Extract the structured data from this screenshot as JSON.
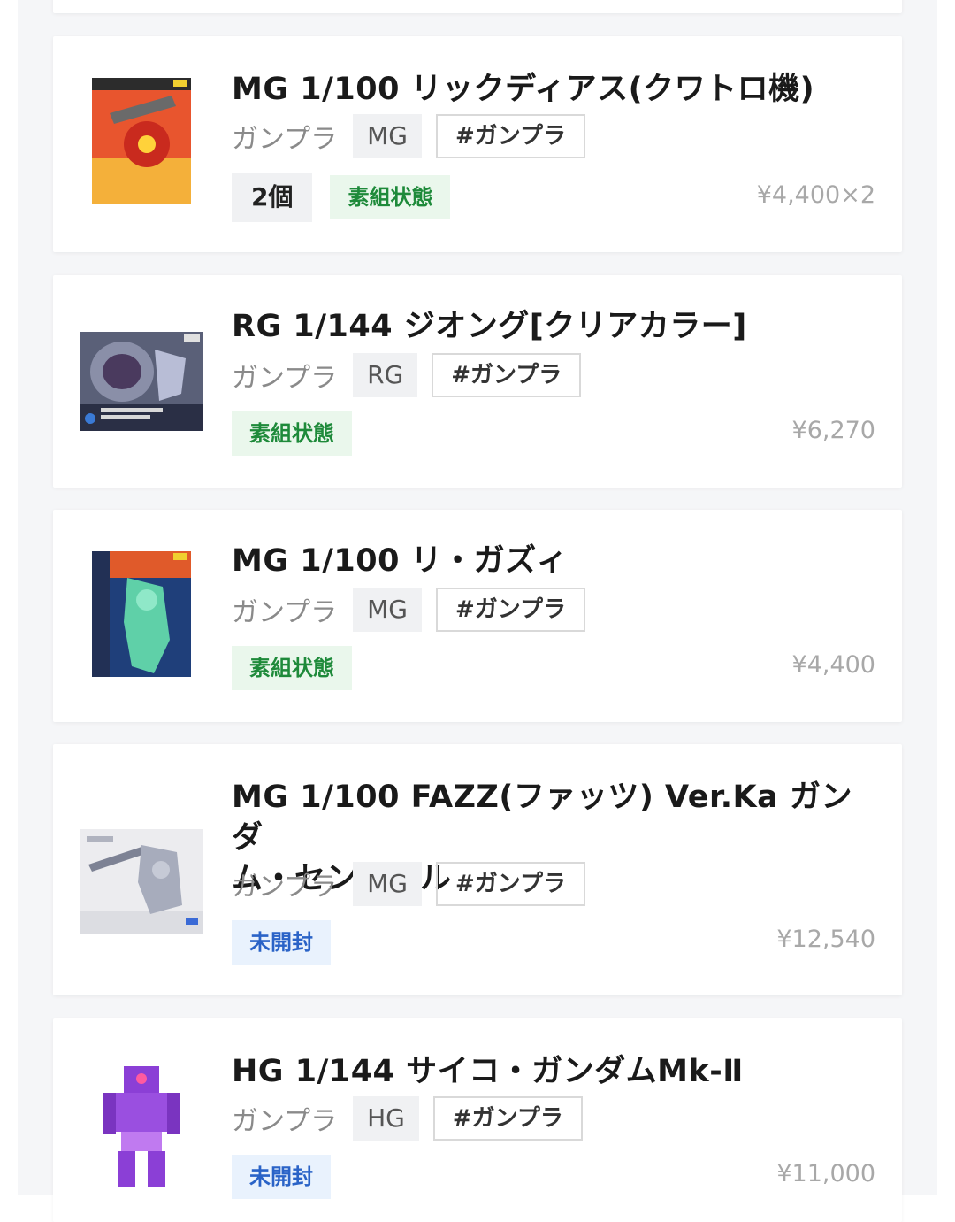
{
  "items": [
    {
      "title": "MG 1/100 リックディアス(クワトロ機)",
      "category": "ガンプラ",
      "series": "MG",
      "hashtag": "#ガンプラ",
      "quantity": "2個",
      "condition": "素組状態",
      "condition_color": "#1e8a3a",
      "price": "¥4,400×2",
      "thumb_colors": [
        "#d3402a",
        "#f0a020"
      ]
    },
    {
      "title": "RG 1/144 ジオング[クリアカラー]",
      "category": "ガンプラ",
      "series": "RG",
      "hashtag": "#ガンプラ",
      "condition": "素組状態",
      "condition_color": "#1e8a3a",
      "price": "¥6,270",
      "thumb_colors": [
        "#4a4f66",
        "#9aa0b8"
      ]
    },
    {
      "title": "MG 1/100 リ・ガズィ",
      "category": "ガンプラ",
      "series": "MG",
      "hashtag": "#ガンプラ",
      "condition": "素組状態",
      "condition_color": "#1e8a3a",
      "price": "¥4,400",
      "thumb_colors": [
        "#1f3f7a",
        "#5fd0a8"
      ]
    },
    {
      "title_line1": "MG 1/100 FAZZ(ファッツ) Ver.Ka ガンダ",
      "title_line2": "ム・センチネル",
      "category": "ガンプラ",
      "series": "MG",
      "hashtag": "#ガンプラ",
      "condition": "未開封",
      "condition_color": "#2a63c7",
      "price": "¥12,540",
      "thumb_colors": [
        "#e8e8ea",
        "#8a8fa0"
      ]
    },
    {
      "title": "HG 1/144 サイコ・ガンダムMk-Ⅱ",
      "category": "ガンプラ",
      "series": "HG",
      "hashtag": "#ガンプラ",
      "condition": "未開封",
      "condition_color": "#2a63c7",
      "price": "¥11,000",
      "thumb_colors": [
        "#8b3fd6",
        "#c07af0"
      ]
    }
  ]
}
